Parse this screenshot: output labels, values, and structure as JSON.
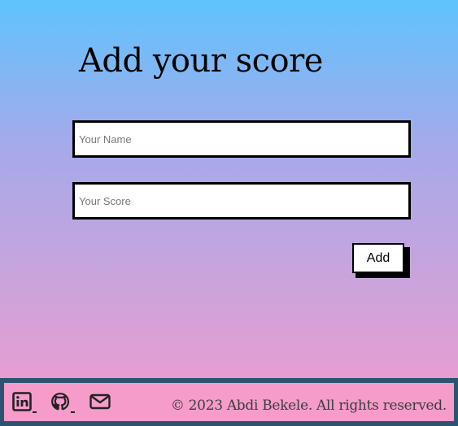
{
  "form": {
    "title": "Add your score",
    "name_placeholder": "Your Name",
    "name_value": "",
    "score_placeholder": "Your Score",
    "score_value": "",
    "add_label": "Add"
  },
  "footer": {
    "social": [
      {
        "icon": "linkedin-icon"
      },
      {
        "icon": "github-icon"
      },
      {
        "icon": "mail-icon"
      }
    ],
    "copyright": "© 2023 Abdi Bekele. All rights reserved."
  },
  "colors": {
    "gradient_top": "#5fc3fd",
    "gradient_bottom": "#f49bcd",
    "footer_border": "#2c5470",
    "footer_background": "#f59ccb"
  }
}
